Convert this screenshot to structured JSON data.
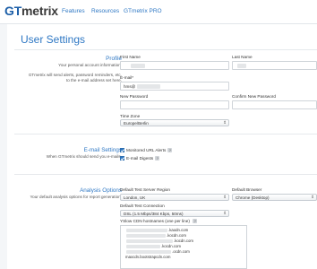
{
  "header": {
    "logo_gt": "GT",
    "logo_metrix": "metrix",
    "nav": [
      "Features",
      "Resources",
      "GTmetrix PRO"
    ]
  },
  "page": {
    "title": "User Settings"
  },
  "profile": {
    "title": "Profile",
    "desc1": "Your personal account information.",
    "desc2": "GTmetrix will send alerts, password reminders, etc. to the e-mail address set here.",
    "first_name_label": "First Name",
    "last_name_label": "Last Name",
    "email_label": "E-mail*",
    "email_value": "hms@",
    "new_password_label": "New Password",
    "confirm_password_label": "Confirm New Password",
    "timezone_label": "Time Zone",
    "timezone_value": "Europe/Berlin"
  },
  "email_settings": {
    "title": "E-mail Settings",
    "desc": "When GTmetrix should send you e-mails.",
    "monitored_alerts": "Monitored URL Alerts",
    "email_digests": "E-mail Digests",
    "help": "?"
  },
  "analysis": {
    "title": "Analysis Options",
    "desc": "Your default analysis options for report generation.",
    "test_region_label": "Default Test Server Region",
    "test_region_value": "London, UK",
    "browser_label": "Default Browser",
    "browser_value": "Chrome (Desktop)",
    "connection_label": "Default Test Connection",
    "connection_value": "DSL (1.5 Mbps/384 Kbps, 50ms)",
    "cdn_label": "YSlow CDN hostnames (one per line)",
    "cdn_lines": [
      ".kaodn.com",
      ".kocdn.com",
      ".kocdn.com",
      ".kocdn.com",
      ".ocdn.com",
      "maxcdn.bootstrapcdn.com"
    ],
    "help": "?"
  }
}
